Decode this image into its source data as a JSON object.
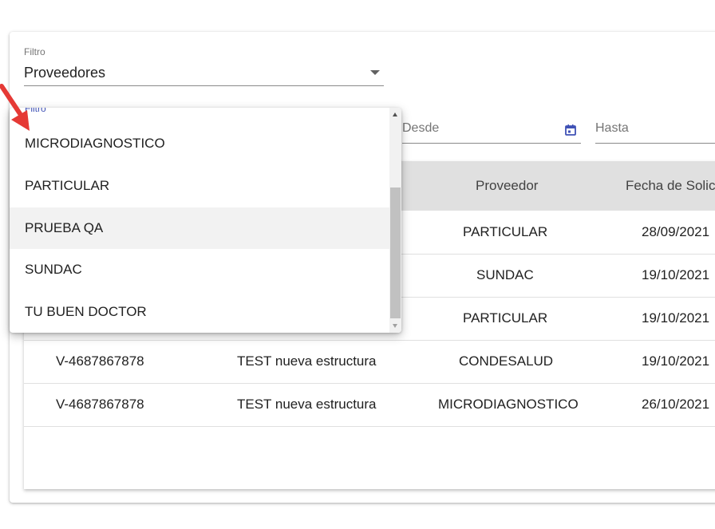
{
  "filter1": {
    "label": "Filtro",
    "value": "Proveedores"
  },
  "filter2": {
    "label": "Filtro"
  },
  "date_from": {
    "placeholder": "Desde"
  },
  "date_to": {
    "placeholder": "Hasta"
  },
  "table": {
    "headers": [
      "Proveedor",
      "Fecha de Solic"
    ],
    "rows": [
      {
        "cedula": "",
        "descripcion": "",
        "proveedor": "PARTICULAR",
        "fecha": "28/09/2021"
      },
      {
        "cedula": "",
        "descripcion": "",
        "proveedor": "SUNDAC",
        "fecha": "19/10/2021"
      },
      {
        "cedula": "",
        "descripcion": "",
        "proveedor": "PARTICULAR",
        "fecha": "19/10/2021"
      },
      {
        "cedula": "V-4687867878",
        "descripcion": "TEST nueva estructura",
        "proveedor": "CONDESALUD",
        "fecha": "19/10/2021"
      },
      {
        "cedula": "V-4687867878",
        "descripcion": "TEST nueva estructura",
        "proveedor": "MICRODIAGNOSTICO",
        "fecha": "26/10/2021"
      }
    ]
  },
  "dropdown": {
    "items": [
      "MICRODIAGNOSTICO",
      "PARTICULAR",
      "PRUEBA QA",
      "SUNDAC",
      "TU BUEN DOCTOR"
    ],
    "highlighted": "PRUEBA QA"
  },
  "colors": {
    "accent": "#3f51b5",
    "annotation_arrow": "#e53935",
    "header_bg": "#e0e0e0"
  },
  "icons": {
    "calendar": "calendar-icon",
    "caret": "chevron-down-icon"
  }
}
